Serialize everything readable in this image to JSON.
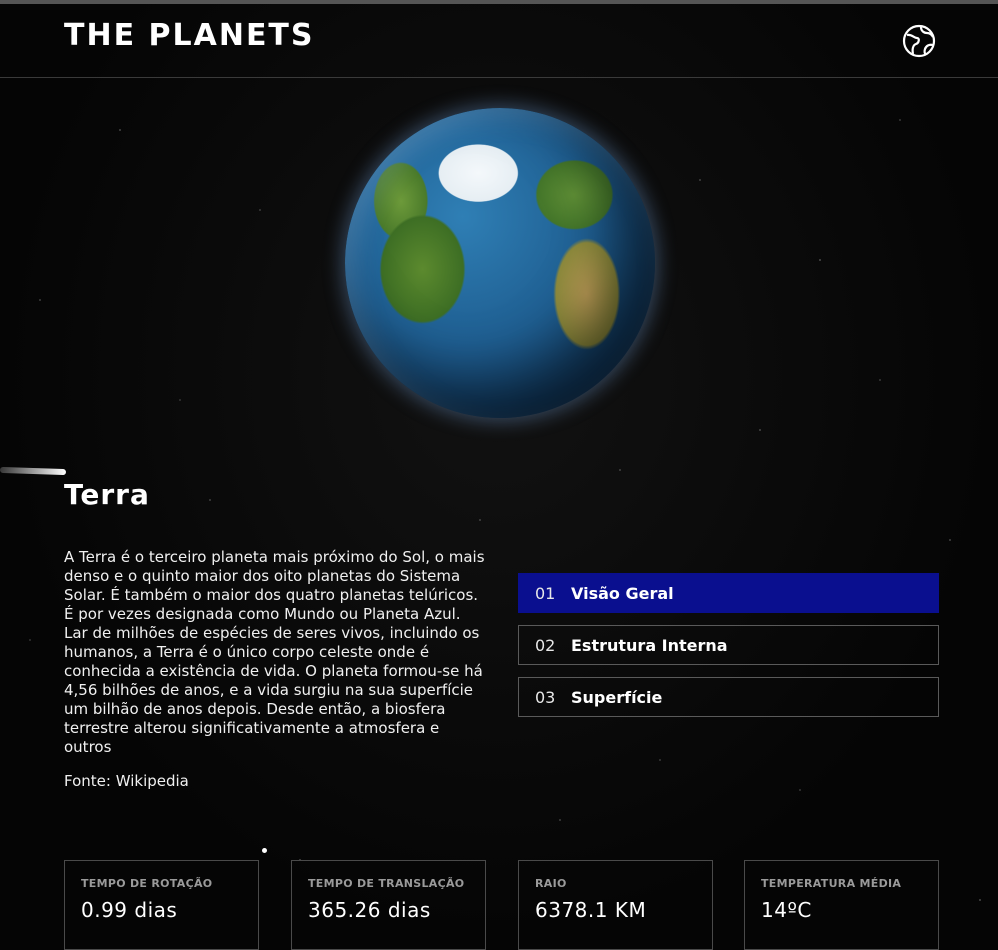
{
  "header": {
    "logo": "THE PLANETS",
    "menu_icon": "globe-icon"
  },
  "planet": {
    "name": "Terra",
    "description": "A Terra é o terceiro planeta mais próximo do Sol, o mais denso e o quinto maior dos oito planetas do Sistema Solar. É também o maior dos quatro planetas telúricos. É por vezes designada como Mundo ou Planeta Azul. Lar de milhões de espécies de seres vivos, incluindo os humanos, a Terra é o único corpo celeste onde é conhecida a existência de vida. O planeta formou-se há 4,56 bilhões de anos, e a vida surgiu na sua superfície um bilhão de anos depois. Desde então, a biosfera terrestre alterou significativamente a atmosfera e outros",
    "source": "Fonte: Wikipedia"
  },
  "tabs": [
    {
      "num": "01",
      "label": "Visão Geral",
      "active": true
    },
    {
      "num": "02",
      "label": "Estrutura Interna",
      "active": false
    },
    {
      "num": "03",
      "label": "Superfície",
      "active": false
    }
  ],
  "stats": [
    {
      "label": "TEMPO DE ROTAÇÃO",
      "value": "0.99 dias"
    },
    {
      "label": "TEMPO DE TRANSLAÇÃO",
      "value": "365.26 dias"
    },
    {
      "label": "RAIO",
      "value": "6378.1 KM"
    },
    {
      "label": "TEMPERATURA MÉDIA",
      "value": "14ºC"
    }
  ],
  "colors": {
    "active_tab": "#0a0f8f",
    "background": "#050505"
  }
}
